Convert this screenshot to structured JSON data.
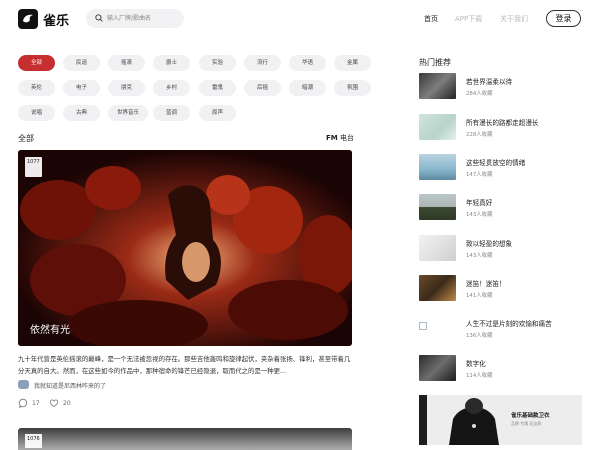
{
  "header": {
    "logo_text": "雀乐",
    "search_placeholder": "输入厂牌/歌曲名",
    "nav_home": "首页",
    "nav_app": "APP下载",
    "nav_about": "关于我们",
    "login_label": "登录"
  },
  "tags": [
    "全部",
    "民谣",
    "摇滚",
    "爵士",
    "实验",
    "流行",
    "华语",
    "金属",
    "英伦",
    "电子",
    "朋克",
    "乡村",
    "雷鬼",
    "后摇",
    "暗潮",
    "氛围",
    "说唱",
    "古典",
    "世界音乐",
    "蓝调",
    "原声"
  ],
  "active_tag": "全部",
  "colors": {
    "accent": "#c62f2f"
  },
  "section": {
    "title": "全部",
    "radio_icon": "FM",
    "radio_label": "电台"
  },
  "card": {
    "badge": "1077",
    "caption": "依然有光",
    "description": "九十年代曾是英伦摇滚的巅峰，是一个无法被忽视的存在。那些吉他轰鸣和旋律起伏，夹杂着张扬、锋利，甚至带着几分天真的自大。然而，在这些如今的作品中，那种宿命的锋芒已经隐退，取而代之的是一种更...",
    "author": "我就知道是尼西林咋来的了",
    "comments": "17",
    "likes": "20"
  },
  "card2": {
    "badge": "1076"
  },
  "hot": {
    "title": "热门推荐",
    "items": [
      {
        "name": "若世界温柔以待",
        "count": "284人收藏"
      },
      {
        "name": "所有漫长的路都走超漫长",
        "count": "228人收藏"
      },
      {
        "name": "这些轻贯放空的情绪",
        "count": "147人收藏"
      },
      {
        "name": "年轻真好",
        "count": "143人收藏"
      },
      {
        "name": "致以轻盈的想象",
        "count": "143人收藏"
      },
      {
        "name": "迷笛！迷笛！",
        "count": "141人收藏"
      },
      {
        "name": "人生不过是片刻的欢愉和痛苦",
        "count": "136人收藏"
      },
      {
        "name": "数字化",
        "count": "114人收藏"
      }
    ]
  },
  "banner": {
    "title": "雀乐基础款卫衣",
    "subtitle": "品牌 专属 纪念款"
  }
}
